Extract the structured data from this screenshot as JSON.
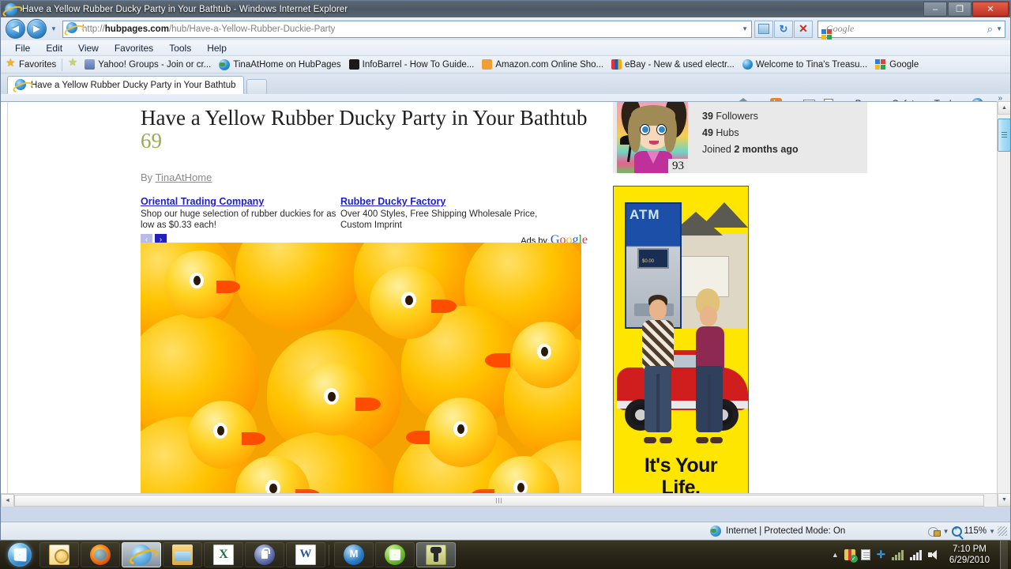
{
  "window": {
    "title": "Have a Yellow Rubber Ducky Party in Your Bathtub - Windows Internet Explorer",
    "minimize_label": "–",
    "maximize_label": "❐",
    "close_label": "✕"
  },
  "navigation": {
    "back_label": "◄",
    "forward_label": "►",
    "history_caret": "▼",
    "url_prefix": "http://",
    "url_domain": "hubpages.com",
    "url_path": "/hub/Have-a-Yellow-Rubber-Duckie-Party",
    "url_caret": "▼",
    "refresh_label": "↻",
    "stop_label": "✕",
    "compat_label": "⛶"
  },
  "search": {
    "placeholder": "Google",
    "engine_caret": "▼",
    "go_label": "⌕"
  },
  "menubar": {
    "items": [
      "File",
      "Edit",
      "View",
      "Favorites",
      "Tools",
      "Help"
    ]
  },
  "favorites_bar": {
    "favorites_label": "Favorites",
    "items": [
      {
        "label": "Yahoo! Groups - Join or cr...",
        "icon": "yahoo-groups-icon"
      },
      {
        "label": "TinaAtHome on HubPages",
        "icon": "globe-icon"
      },
      {
        "label": "InfoBarrel - How To Guide...",
        "icon": "infobarrel-icon"
      },
      {
        "label": "Amazon.com Online Sho...",
        "icon": "amazon-icon"
      },
      {
        "label": "eBay - New & used electr...",
        "icon": "ebay-icon"
      },
      {
        "label": "Welcome to Tina's Treasu...",
        "icon": "globe-icon"
      },
      {
        "label": "Google",
        "icon": "google-icon"
      }
    ]
  },
  "tabs": {
    "active_tab_label": "Have a Yellow Rubber Ducky Party in Your Bathtub",
    "new_tab_label": ""
  },
  "command_bar": {
    "home_caret": "▼",
    "feeds_caret": "▼",
    "print_caret": "▼",
    "page_label": "Page",
    "safety_label": "Safety",
    "tools_label": "Tools",
    "help_label": "?",
    "help_caret": "▼",
    "overflow_label": "»"
  },
  "page": {
    "title_main": "Have a Yellow Rubber Ducky Party in Your Bathtub",
    "title_score": "69",
    "byline_prefix": "By",
    "byline_author": "TinaAtHome",
    "ads": [
      {
        "title": "Oriental Trading Company",
        "body": "Shop our huge selection of rubber duckies for as low as $0.33 each!"
      },
      {
        "title": "Rubber Ducky Factory",
        "body": "Over 400 Styles, Free Shipping Wholesale Price, Custom Imprint"
      }
    ],
    "ad_prev_label": "‹",
    "ad_next_label": "›",
    "ads_by_label": "Ads by",
    "ads_by_brand": "Google",
    "hero_image_alt": "yellow rubber ducks"
  },
  "profile": {
    "score": "93",
    "followers_count": "39",
    "followers_label": "Followers",
    "hubs_count": "49",
    "hubs_label": "Hubs",
    "joined_prefix": "Joined",
    "joined_value": "2 months ago"
  },
  "banner_ad": {
    "atm_label": "ATM",
    "atm_screen_text": "$0.00",
    "tagline_line1": "It's Your",
    "tagline_line2": "Life."
  },
  "scrollbars": {
    "up_arrow": "▲",
    "down_arrow": "▼",
    "left_arrow": "◄",
    "right_arrow": "►"
  },
  "status_bar": {
    "zone_text": "Internet | Protected Mode: On",
    "protected_caret": "▼",
    "zoom_level": "115%",
    "zoom_caret": "▼"
  },
  "taskbar": {
    "buttons": [
      {
        "name": "outlook",
        "label": ""
      },
      {
        "name": "firefox",
        "label": ""
      },
      {
        "name": "internet-explorer",
        "label": ""
      },
      {
        "name": "windows-explorer",
        "label": ""
      },
      {
        "name": "excel",
        "label": ""
      },
      {
        "name": "security-app",
        "label": ""
      },
      {
        "name": "word",
        "label": ""
      },
      {
        "name": "msn-messenger",
        "label": ""
      },
      {
        "name": "windows-app",
        "label": ""
      },
      {
        "name": "tool-app",
        "label": ""
      }
    ],
    "tray_overflow": "▲",
    "clock_time": "7:10 PM",
    "clock_date": "6/29/2010"
  }
}
